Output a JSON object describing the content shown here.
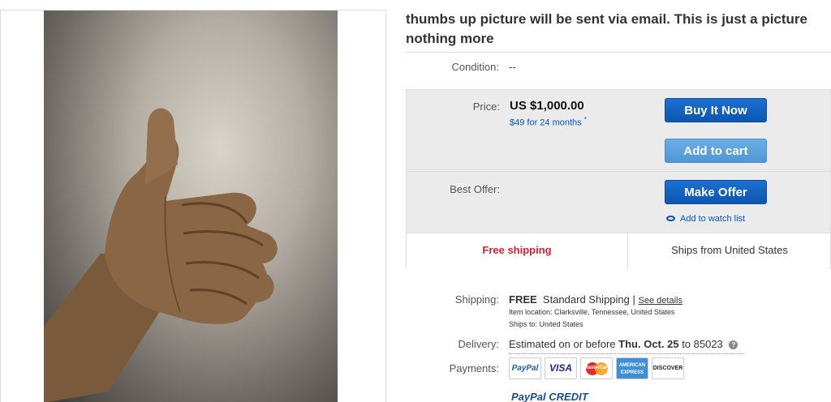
{
  "listing": {
    "title": "thumbs up picture will be sent via email.  This is just a picture nothing more"
  },
  "condition": {
    "label": "Condition:",
    "value": "--"
  },
  "price": {
    "label": "Price:",
    "value": "US $1,000.00",
    "finance": "$49 for 24 months",
    "finance_mark": "*"
  },
  "buttons": {
    "buy_now": "Buy It Now",
    "add_to_cart": "Add to cart",
    "make_offer": "Make Offer",
    "watch": "Add to watch list"
  },
  "best_offer": {
    "label": "Best Offer:"
  },
  "shipping_strip": {
    "free": "Free shipping",
    "ships_from": "Ships from United States"
  },
  "shipping": {
    "label": "Shipping:",
    "free": "FREE",
    "method": "Standard Shipping",
    "separator": "|",
    "see_details": "See details",
    "location": "Item location:  Clarksville, Tennessee, United States",
    "ships_to": "Ships to:  United States"
  },
  "delivery": {
    "label": "Delivery:",
    "prefix": "Estimated on or before",
    "date": "Thu. Oct. 25",
    "suffix": "to 85023",
    "info": "?"
  },
  "payments": {
    "label": "Payments:",
    "methods": [
      "PayPal",
      "VISA",
      "MasterCard",
      "AMERICAN EXPRESS",
      "DISCOVER"
    ],
    "paypal_credit": "PayPal CREDIT"
  },
  "colors": {
    "primary_button": "#0c57b0",
    "secondary_button": "#4f97d6",
    "link": "#0654ba",
    "free_shipping": "#dd1e31"
  }
}
